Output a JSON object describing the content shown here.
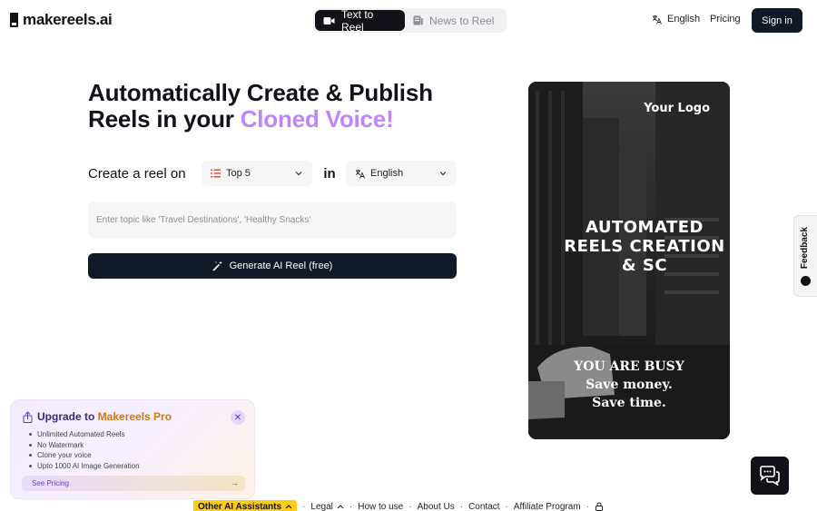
{
  "header": {
    "logo_text": "makereels.ai",
    "modes": [
      {
        "label": "Text to Reel",
        "icon": "video-camera-icon",
        "active": true
      },
      {
        "label": "News to Reel",
        "icon": "newspaper-icon",
        "active": false
      }
    ],
    "language_label": "English",
    "pricing_label": "Pricing",
    "signin_label": "Sign in"
  },
  "hero": {
    "title_line1": "Automatically Create & Publish",
    "title_line2_prefix": "Reels in your ",
    "title_line2_accent": "Cloned Voice!"
  },
  "form": {
    "create_label": "Create a reel on",
    "format_value": "Top 5",
    "in_label": "in",
    "language_value": "English",
    "topic_placeholder": "Enter topic like 'Travel Destinations', 'Healthy Snacks'",
    "generate_label": "Generate AI Reel (free)"
  },
  "preview": {
    "logo_text": "Your Logo",
    "headline": "AUTOMATED REELS CREATION & SC",
    "busy_line1": "YOU ARE BUSY",
    "busy_line2": "Save money.",
    "busy_line3": "Save time."
  },
  "feedback_label": "Feedback",
  "upgrade": {
    "title_prefix": "Upgrade to ",
    "title_brand": "Makereels Pro",
    "features": [
      "Unlimited Automated Reels",
      "No Watermark",
      "Clone your voice",
      "Upto 1000 AI Image Generation"
    ],
    "cta_label": "See Pricing"
  },
  "footer": {
    "assistants_label": "Other AI Assistants",
    "links": [
      "Legal",
      "How to use",
      "About Us",
      "Contact",
      "Affiliate Program"
    ]
  },
  "colors": {
    "accent_purple": "#c084fc",
    "dark": "#111827",
    "assistants_yellow": "#facc15"
  }
}
